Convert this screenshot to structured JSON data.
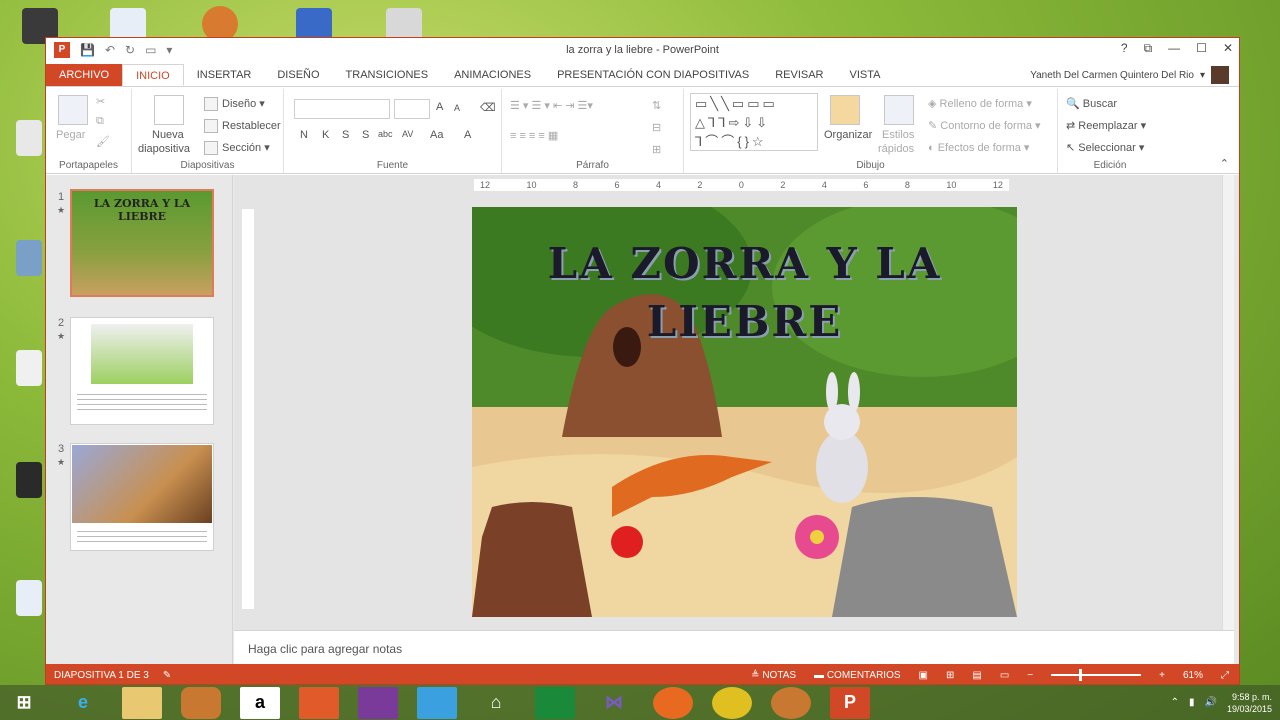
{
  "window": {
    "title": "la zorra y la liebre - PowerPoint",
    "controls": [
      "?",
      "⧉",
      "—",
      "☐",
      "✕"
    ]
  },
  "tabs": [
    "ARCHIVO",
    "INICIO",
    "INSERTAR",
    "DISEÑO",
    "TRANSICIONES",
    "ANIMACIONES",
    "PRESENTACIÓN CON DIAPOSITIVAS",
    "REVISAR",
    "VISTA"
  ],
  "user": {
    "name": "Yaneth Del Carmen Quintero Del Rio"
  },
  "ribbon": {
    "clipboard": {
      "paste": "Pegar",
      "label": "Portapapeles"
    },
    "slides": {
      "new_slide": "Nueva",
      "new_slide2": "diapositiva",
      "layout": "Diseño",
      "reset": "Restablecer",
      "section": "Sección",
      "label": "Diapositivas"
    },
    "font": {
      "bold": "N",
      "italic": "K",
      "underline": "S",
      "shadow": "S",
      "strike": "abc",
      "spacing": "AV",
      "case": "Aa",
      "color": "A",
      "grow": "A",
      "shrink": "A",
      "label": "Fuente"
    },
    "paragraph": {
      "label": "Párrafo"
    },
    "drawing": {
      "arrange": "Organizar",
      "quick_styles": "Estilos",
      "quick_styles2": "rápidos",
      "fill": "Relleno de forma",
      "outline": "Contorno de forma",
      "effects": "Efectos de forma",
      "label": "Dibujo"
    },
    "editing": {
      "find": "Buscar",
      "replace": "Reemplazar",
      "select": "Seleccionar",
      "label": "Edición"
    }
  },
  "ruler": {
    "h_ticks": [
      "12",
      "10",
      "8",
      "6",
      "4",
      "2",
      "0",
      "2",
      "4",
      "6",
      "8",
      "10",
      "12"
    ]
  },
  "thumbnails": [
    {
      "num": "1",
      "star": "★",
      "title": "LA ZORRA Y LA LIEBRE",
      "selected": true
    },
    {
      "num": "2",
      "star": "★",
      "selected": false
    },
    {
      "num": "3",
      "star": "★",
      "selected": false
    }
  ],
  "slide": {
    "title": "LA ZORRA Y LA LIEBRE"
  },
  "notes": {
    "placeholder": "Haga clic para agregar notas"
  },
  "status": {
    "slide_info": "DIAPOSITIVA 1 DE 3",
    "notes": "NOTAS",
    "comments": "COMENTARIOS",
    "zoom_minus": "−",
    "zoom_plus": "+",
    "zoom": "61%"
  },
  "taskbar": {
    "time": "9:58 p. m.",
    "date": "19/03/2015"
  },
  "colors": {
    "accent": "#d24726",
    "file_tab": "#d24726"
  }
}
